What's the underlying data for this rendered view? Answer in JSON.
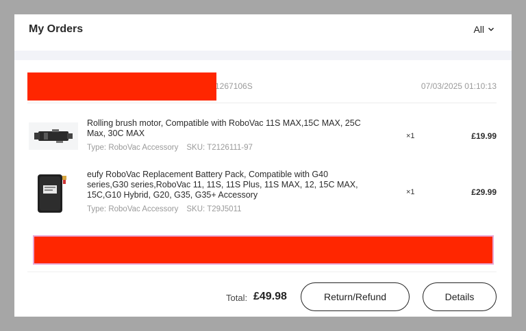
{
  "header": {
    "title": "My Orders",
    "filter_label": "All",
    "filter_icon": "chevron-down-icon"
  },
  "order": {
    "id_visible_tail": "1267106S",
    "date": "07/03/2025 01:10:13",
    "items": [
      {
        "name": "Rolling brush motor, Compatible with RoboVac 11S MAX,15C MAX, 25C Max, 30C MAX",
        "type_label": "Type: RoboVac Accessory",
        "sku_label": "SKU: T2126111-97",
        "qty": "×1",
        "price": "£19.99",
        "image_icon": "motor-product-image"
      },
      {
        "name": "eufy RoboVac Replacement Battery Pack, Compatible with G40 series,G30 series,RoboVac 11, 11S, 11S Plus, 11S MAX, 12, 15C MAX, 15C,G10 Hybrid, G20, G35, G35+ Accessory",
        "type_label": "Type: RoboVac Accessory",
        "sku_label": "SKU: T29J5011",
        "qty": "×1",
        "price": "£29.99",
        "image_icon": "battery-product-image"
      }
    ],
    "total_label": "Total:",
    "total_value": "£49.98"
  },
  "actions": {
    "return_label": "Return/Refund",
    "details_label": "Details"
  },
  "colors": {
    "redaction": "#ff2600",
    "backdrop": "#a6a6a6",
    "band": "#f2f3f8"
  }
}
